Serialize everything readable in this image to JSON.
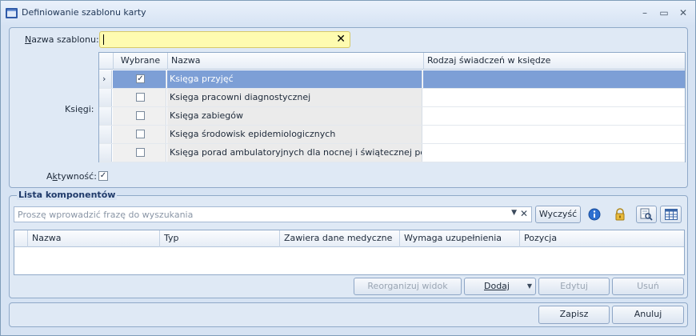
{
  "window": {
    "title": "Definiowanie szablonu karty",
    "controls": {
      "minimize": "–",
      "maximize": "▭",
      "close": "✕"
    }
  },
  "form": {
    "name_label_prefix": "N",
    "name_label_rest": "azwa szablonu:",
    "name_value": "",
    "books_label": "Księgi:",
    "active_label_prefix": "A",
    "active_label_u": "k",
    "active_label_rest": "tywność:",
    "active_checked": "✓"
  },
  "books_grid": {
    "columns": [
      "Wybrane",
      "Nazwa",
      "Rodzaj świadczeń w księdze"
    ],
    "rows": [
      {
        "checked": "✓",
        "name": "Księga przyjęć",
        "kind": "",
        "active": true
      },
      {
        "checked": "",
        "name": "Księga pracowni diagnostycznej",
        "kind": ""
      },
      {
        "checked": "",
        "name": "Księga zabiegów",
        "kind": ""
      },
      {
        "checked": "",
        "name": "Księga środowisk epidemiologicznych",
        "kind": ""
      },
      {
        "checked": "",
        "name": "Księga porad ambulatoryjnych dla nocnej i świątecznej pomocy…",
        "kind": ""
      }
    ]
  },
  "components": {
    "group_title": "Lista komponentów",
    "search_placeholder": "Proszę wprowadzić frazę do wyszukania",
    "clear_button": "Wyczyść",
    "columns": [
      "Nazwa",
      "Typ",
      "Zawiera dane medyczne",
      "Wymaga uzupełnienia",
      "Pozycja"
    ],
    "buttons": {
      "reorganize": "Reorganizuj widok",
      "add": "Dodaj",
      "edit": "Edytuj",
      "remove": "Usuń"
    }
  },
  "footer": {
    "save": "Zapisz",
    "cancel": "Anuluj"
  },
  "icons": [
    "app-icon",
    "info-icon",
    "lock-icon",
    "find-icon",
    "grid-view-icon",
    "clear-x-icon",
    "dropdown-icon",
    "row-pointer-icon"
  ],
  "colors": {
    "selected_row": "#7d9fd6",
    "name_input_bg": "#fefbb0",
    "panel_bg": "#dfe9f5",
    "window_bg": "#d6e3f3"
  }
}
